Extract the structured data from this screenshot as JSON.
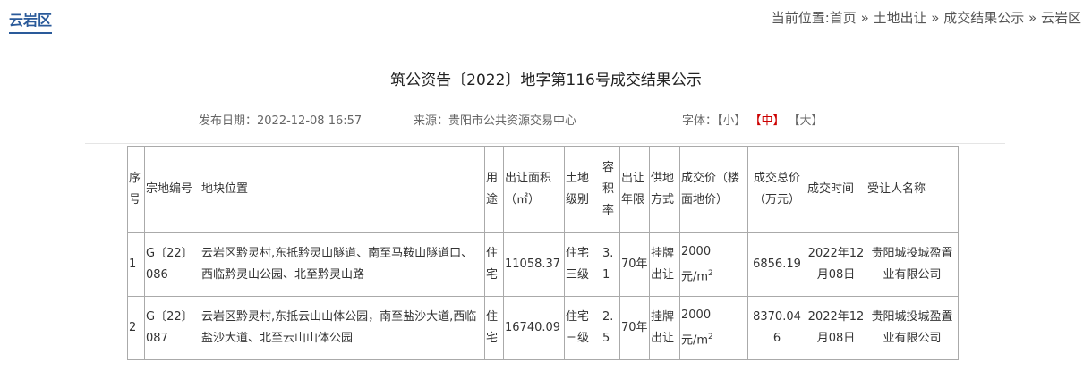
{
  "header": {
    "section_title": "云岩区",
    "breadcrumb": {
      "prefix": "当前位置:",
      "items": [
        "首页",
        "土地出让",
        "成交结果公示",
        "云岩区"
      ],
      "separator": " » "
    }
  },
  "article": {
    "title": "筑公资告〔2022〕地字第116号成交结果公示",
    "publish_label": "发布日期：",
    "publish_date": "2022-12-08 16:57",
    "source_label": "来源：",
    "source": "贵阳市公共资源交易中心",
    "font_label": "字体：",
    "font_small": "【小】",
    "font_medium": "【中】",
    "font_large": "【大】"
  },
  "table": {
    "headers": {
      "seq": "序号",
      "parcel_no": "宗地编号",
      "location": "地块位置",
      "use": "用途",
      "area": "出让面积（㎡）",
      "grade": "土地级别",
      "far": "容积率",
      "term": "出让年限",
      "method": "供地方式",
      "unit_price": "成交价（楼面地价）",
      "total_price": "成交总价（万元）",
      "deal_time": "成交时间",
      "buyer": "受让人名称"
    },
    "rows": [
      {
        "seq": "1",
        "parcel_no": "G〔22〕086",
        "location": "云岩区黔灵村,东抵黔灵山隧道、南至马鞍山隧道口、西临黔灵山公园、北至黔灵山路",
        "use": "住宅",
        "area": "11058.37",
        "grade": "住宅三级",
        "far": "3.1",
        "term": "70年",
        "method": "挂牌出让",
        "unit_price": "2000",
        "unit_price_unit": "元/m",
        "unit_price_sup": "2",
        "total_price": "6856.19",
        "deal_time": "2022年12月08日",
        "buyer": "贵阳城投城盈置业有限公司"
      },
      {
        "seq": "2",
        "parcel_no": "G〔22〕087",
        "location": "云岩区黔灵村,东抵云山山体公园，南至盐沙大道,西临盐沙大道、北至云山山体公园",
        "use": "住宅",
        "area": "16740.09",
        "grade": "住宅三级",
        "far": "2.5",
        "term": "70年",
        "method": "挂牌出让",
        "unit_price": "2000",
        "unit_price_unit": "元/m",
        "unit_price_sup": "2",
        "total_price": "8370.046",
        "deal_time": "2022年12月08日",
        "buyer": "贵阳城投城盈置业有限公司"
      }
    ]
  }
}
